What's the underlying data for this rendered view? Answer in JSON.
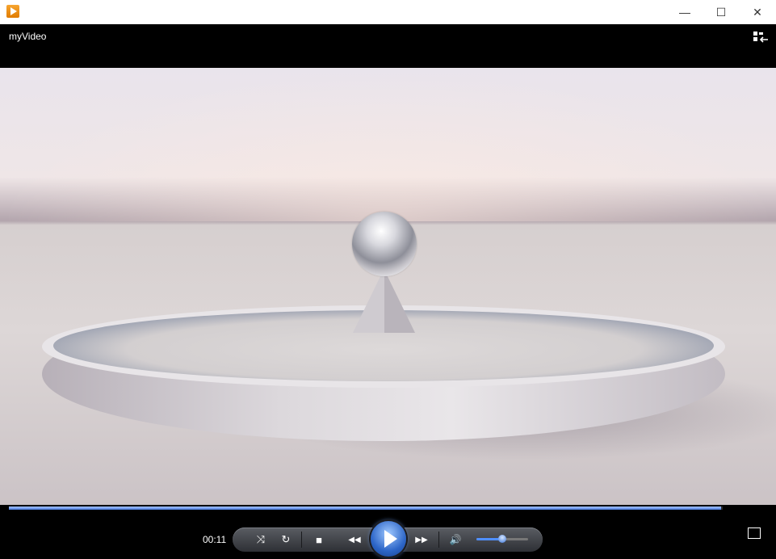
{
  "window": {
    "minimize": "—",
    "maximize": "☐",
    "close": "✕",
    "app_title": "myVideo"
  },
  "playback": {
    "elapsed": "00:11",
    "progress": 0.998,
    "volume": 0.5
  },
  "controls": {
    "shuffle": "⤨",
    "repeat": "↻",
    "stop": "■",
    "previous": "◀◀",
    "next": "▶▶",
    "mute": "🔊"
  },
  "icons": {
    "app": "media-player-icon",
    "switch_library": "switch-to-library-icon",
    "fullscreen": "fullscreen-icon"
  },
  "colors": {
    "accent": "#3f79e0",
    "background": "#000000"
  }
}
